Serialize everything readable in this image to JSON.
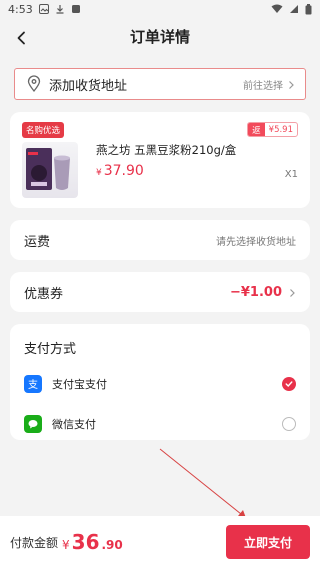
{
  "status_bar": {
    "time": "4:53"
  },
  "header": {
    "title": "订单详情"
  },
  "address": {
    "title": "添加收货地址",
    "hint": "前往选择"
  },
  "product": {
    "badge": "名购优选",
    "refund_tag": "返",
    "refund_value": "¥5.91",
    "title": "燕之坊 五黑豆浆粉210g/盒",
    "price_currency": "¥",
    "price": "37.90",
    "quantity": "X1"
  },
  "shipping": {
    "label": "运费",
    "value": "请先选择收货地址"
  },
  "coupon": {
    "label": "优惠券",
    "value": "−¥1.00"
  },
  "payment": {
    "title": "支付方式",
    "options": [
      {
        "label": "支付宝支付",
        "icon": "alipay-icon",
        "checked": true
      },
      {
        "label": "微信支付",
        "icon": "wechat-icon",
        "checked": false
      }
    ]
  },
  "footer": {
    "total_label": "付款金额",
    "currency": "¥",
    "amount_int": "36",
    "amount_dec": ".90",
    "pay_button": "立即支付"
  },
  "colors": {
    "accent": "#e8314a",
    "background": "#f3f3f3"
  }
}
